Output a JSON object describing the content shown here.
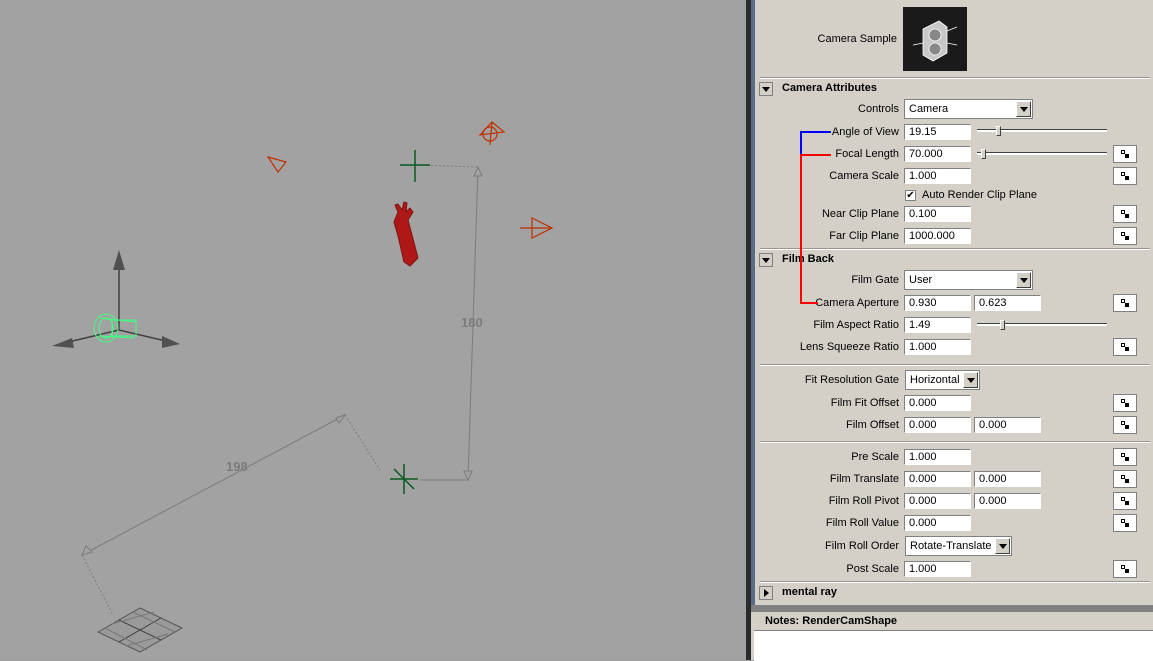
{
  "viewport": {
    "dimension_labels": [
      "180",
      "198"
    ]
  },
  "camera_sample": {
    "label": "Camera Sample"
  },
  "camera_attributes": {
    "title": "Camera Attributes",
    "controls_label": "Controls",
    "controls_value": "Camera",
    "angle_of_view_label": "Angle of View",
    "angle_of_view_value": "19.15",
    "angle_of_view_slider": 0.15,
    "focal_length_label": "Focal Length",
    "focal_length_value": "70.000",
    "focal_length_slider": 0.03,
    "camera_scale_label": "Camera Scale",
    "camera_scale_value": "1.000",
    "auto_render_label": "Auto Render Clip Plane",
    "auto_render_checked": "✔",
    "near_clip_label": "Near Clip Plane",
    "near_clip_value": "0.100",
    "far_clip_label": "Far Clip Plane",
    "far_clip_value": "1000.000"
  },
  "film_back": {
    "title": "Film Back",
    "film_gate_label": "Film Gate",
    "film_gate_value": "User",
    "camera_aperture_label": "Camera Aperture",
    "camera_aperture_x": "0.930",
    "camera_aperture_y": "0.623",
    "film_aspect_label": "Film Aspect Ratio",
    "film_aspect_value": "1.49",
    "film_aspect_slider": 0.18,
    "lens_squeeze_label": "Lens Squeeze Ratio",
    "lens_squeeze_value": "1.000",
    "fit_resolution_label": "Fit Resolution Gate",
    "fit_resolution_value": "Horizontal",
    "film_fit_offset_label": "Film Fit Offset",
    "film_fit_offset_value": "0.000",
    "film_offset_label": "Film Offset",
    "film_offset_x": "0.000",
    "film_offset_y": "0.000",
    "pre_scale_label": "Pre Scale",
    "pre_scale_value": "1.000",
    "film_translate_label": "Film Translate",
    "film_translate_x": "0.000",
    "film_translate_y": "0.000",
    "film_roll_pivot_label": "Film Roll Pivot",
    "film_roll_pivot_x": "0.000",
    "film_roll_pivot_y": "0.000",
    "film_roll_value_label": "Film Roll Value",
    "film_roll_value_value": "0.000",
    "film_roll_order_label": "Film Roll Order",
    "film_roll_order_value": "Rotate-Translate",
    "post_scale_label": "Post Scale",
    "post_scale_value": "1.000"
  },
  "mental_ray": {
    "title": "mental ray"
  },
  "notes": {
    "title": "Notes:  RenderCamShape"
  },
  "colors": {
    "viewport_bg": "#a2a2a2",
    "camera_icons": "#c03000",
    "locator": "#0a5a20",
    "selected_camera": "#40ff80",
    "blue_connector": "#0000ff",
    "red_connector": "#ff0000"
  }
}
